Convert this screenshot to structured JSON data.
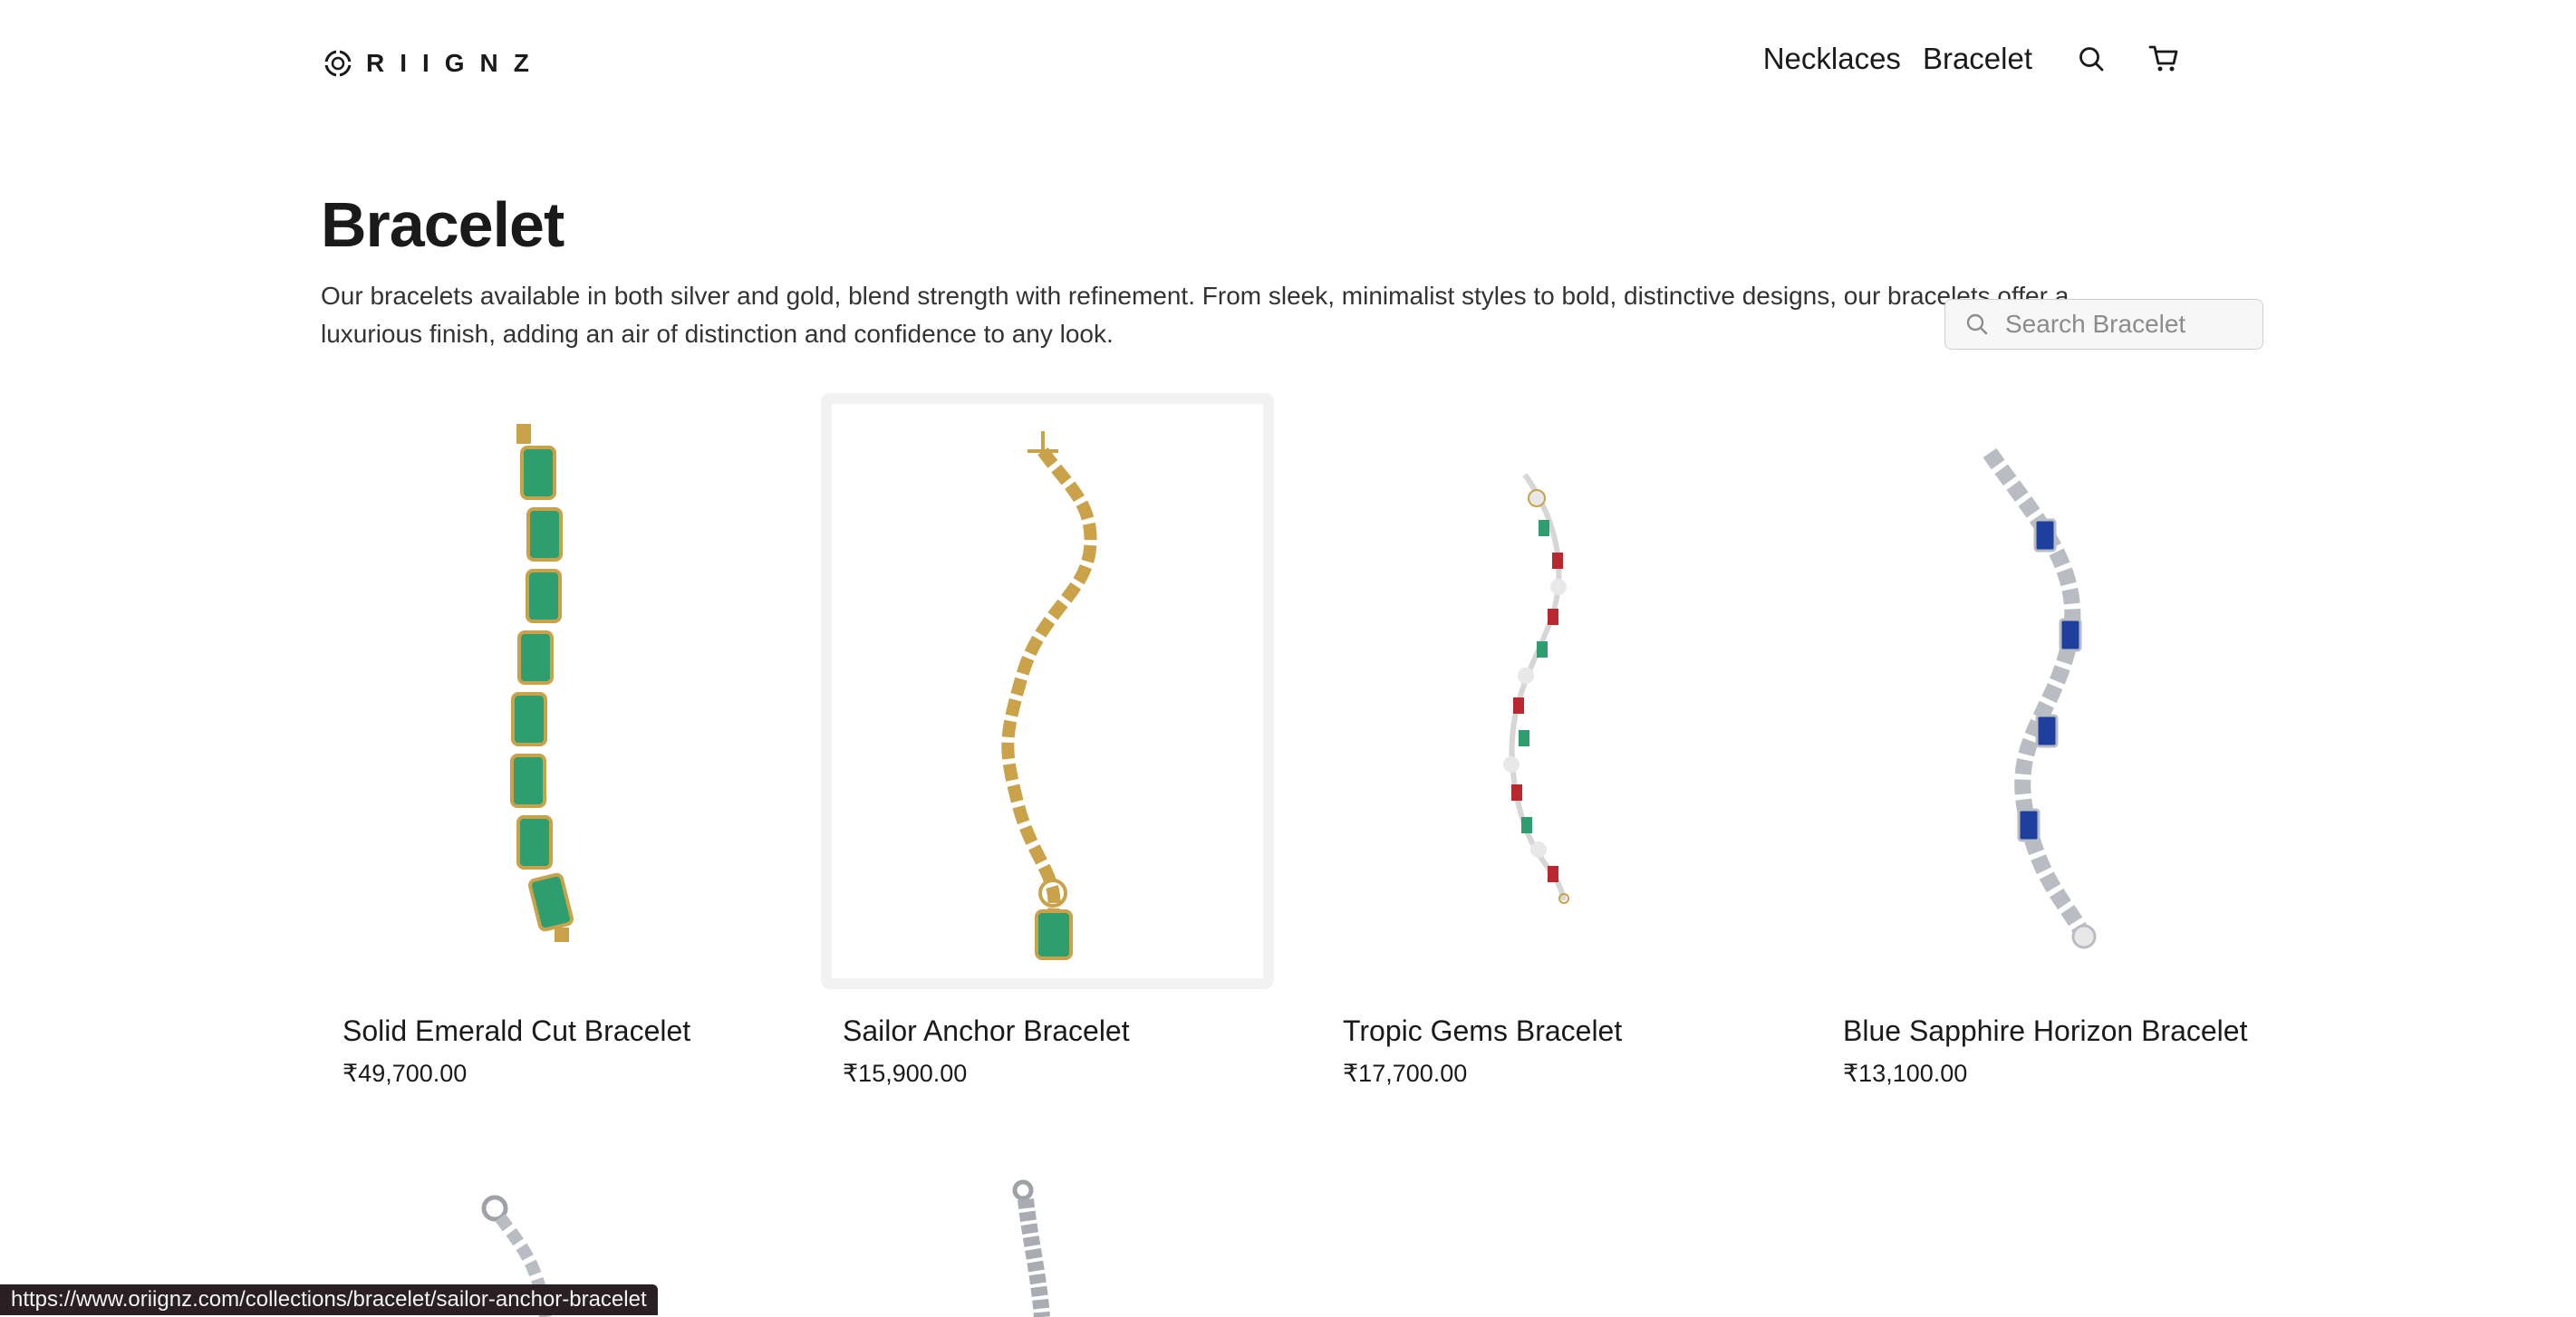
{
  "brand": {
    "logo_text": "RIIGNZ"
  },
  "nav": {
    "links": [
      "Necklaces",
      "Bracelet"
    ],
    "search_icon": "search-icon",
    "cart_icon": "cart-icon"
  },
  "collection": {
    "title": "Bracelet",
    "description": "Our bracelets available in both silver and gold, blend strength with refinement. From sleek, minimalist styles to bold, distinctive designs, our bracelets offer a luxurious finish, adding an air of distinction and confidence to any look.",
    "search_placeholder": "Search Bracelet"
  },
  "products": [
    {
      "name": "Solid Emerald Cut Bracelet",
      "price": "₹49,700.00"
    },
    {
      "name": "Sailor Anchor Bracelet",
      "price": "₹15,900.00"
    },
    {
      "name": "Tropic Gems Bracelet",
      "price": "₹17,700.00"
    },
    {
      "name": "Blue Sapphire Horizon Bracelet",
      "price": "₹13,100.00"
    }
  ],
  "status_bar": {
    "url": "https://www.oriignz.com/collections/bracelet/sailor-anchor-bracelet"
  },
  "colors": {
    "text": "#1a1a1a",
    "emerald": "#2f9e6e",
    "gold": "#c9a24a",
    "ruby": "#b8282e",
    "sapphire": "#1f3f9e",
    "silver": "#b9bcc2"
  }
}
